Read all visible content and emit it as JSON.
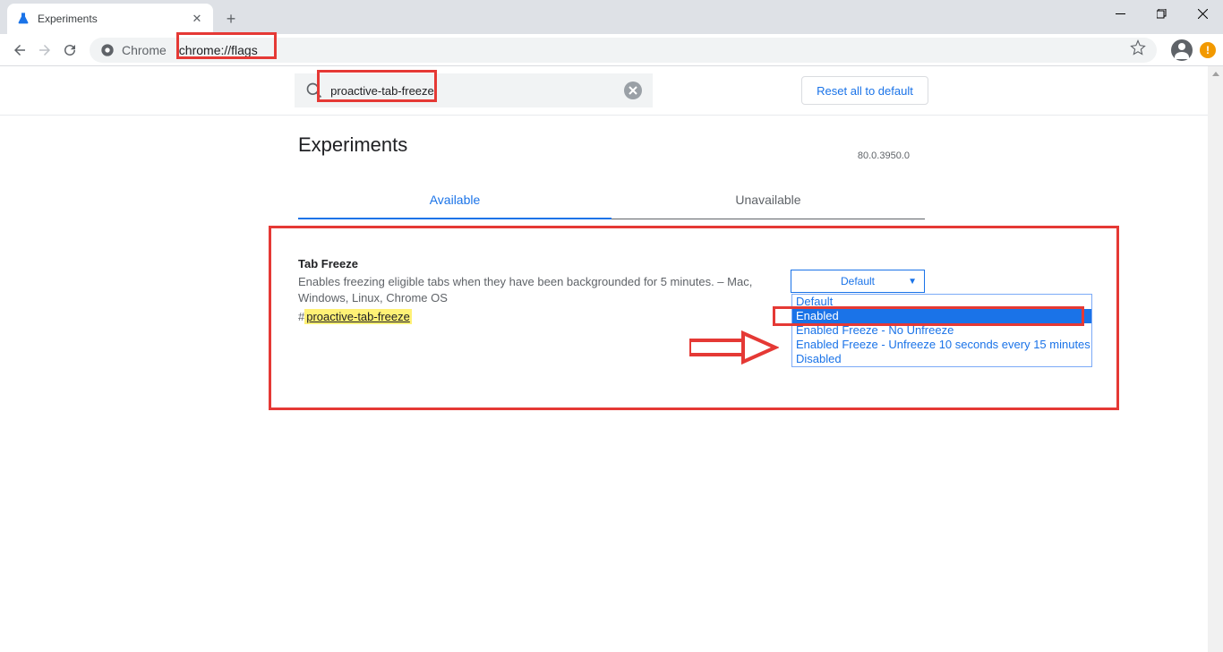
{
  "tab": {
    "title": "Experiments"
  },
  "toolbar": {
    "chrome_label": "Chrome",
    "url": "chrome://flags"
  },
  "search": {
    "value": "proactive-tab-freeze",
    "reset_label": "Reset all to default"
  },
  "page": {
    "heading": "Experiments",
    "version": "80.0.3950.0"
  },
  "tabs": {
    "available": "Available",
    "unavailable": "Unavailable"
  },
  "flag": {
    "title": "Tab Freeze",
    "desc": "Enables freezing eligible tabs when they have been backgrounded for 5 minutes. – Mac, Windows, Linux, Chrome OS",
    "hash_prefix": "#",
    "hash_tag": "proactive-tab-freeze",
    "selected": "Default",
    "options": [
      "Default",
      "Enabled",
      "Enabled Freeze - No Unfreeze",
      "Enabled Freeze - Unfreeze 10 seconds every 15 minutes",
      "Disabled"
    ]
  }
}
